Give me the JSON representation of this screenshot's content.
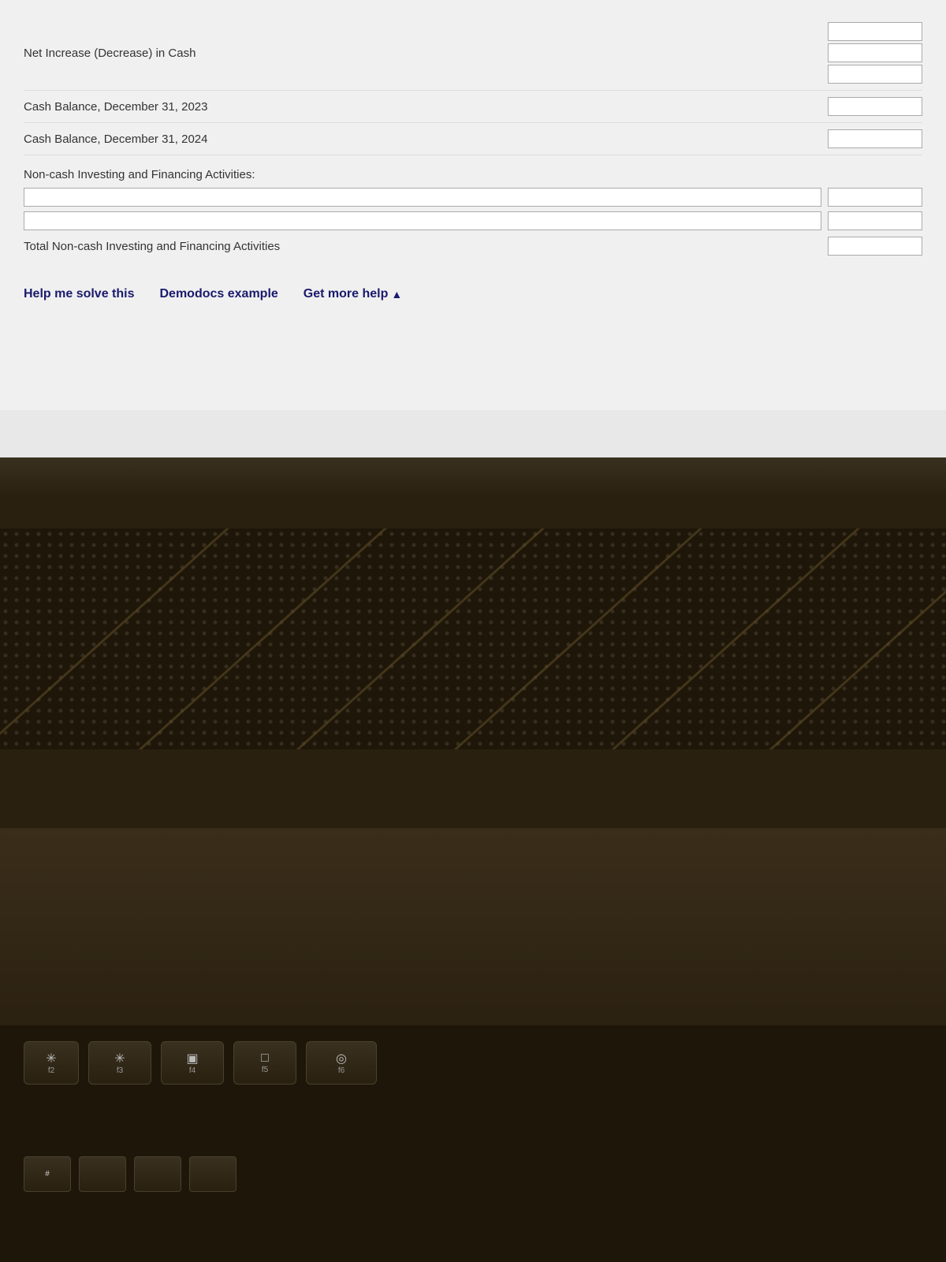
{
  "screen": {
    "rows": [
      {
        "label": "Net Increase (Decrease) in Cash",
        "input_count": 3
      },
      {
        "label": "Cash Balance, December 31, 2023",
        "input_count": 1
      },
      {
        "label": "Cash Balance, December 31, 2024",
        "input_count": 1
      }
    ],
    "non_cash_section": {
      "title": "Non-cash Investing and Financing Activities:",
      "input_rows": 2,
      "total_label": "Total Non-cash Investing and Financing Activities"
    },
    "buttons": [
      {
        "label": "Help me solve this"
      },
      {
        "label": "Demodocs example"
      },
      {
        "label": "Get more help"
      }
    ]
  },
  "taskbar": {
    "icons": [
      "windows-icon",
      "search-icon",
      "window-icon",
      "split-view-icon"
    ]
  },
  "keyboard": {
    "keys": [
      {
        "id": "f2",
        "symbol": "✳",
        "label": "f2"
      },
      {
        "id": "f3",
        "symbol": "✳",
        "label": "f3"
      },
      {
        "id": "f4",
        "symbol": "▣",
        "label": "f4"
      },
      {
        "id": "f5",
        "symbol": "",
        "label": "f5"
      },
      {
        "id": "f6",
        "symbol": "◎",
        "label": "f6"
      }
    ]
  },
  "colors": {
    "screen_bg": "#f0f0f0",
    "taskbar_bg": "#1a1a2e",
    "laptop_body": "#2a2010",
    "key_bg": "#3a3020",
    "link_color": "#1a1a6e",
    "taskbar_icon": "#4db8ff"
  }
}
